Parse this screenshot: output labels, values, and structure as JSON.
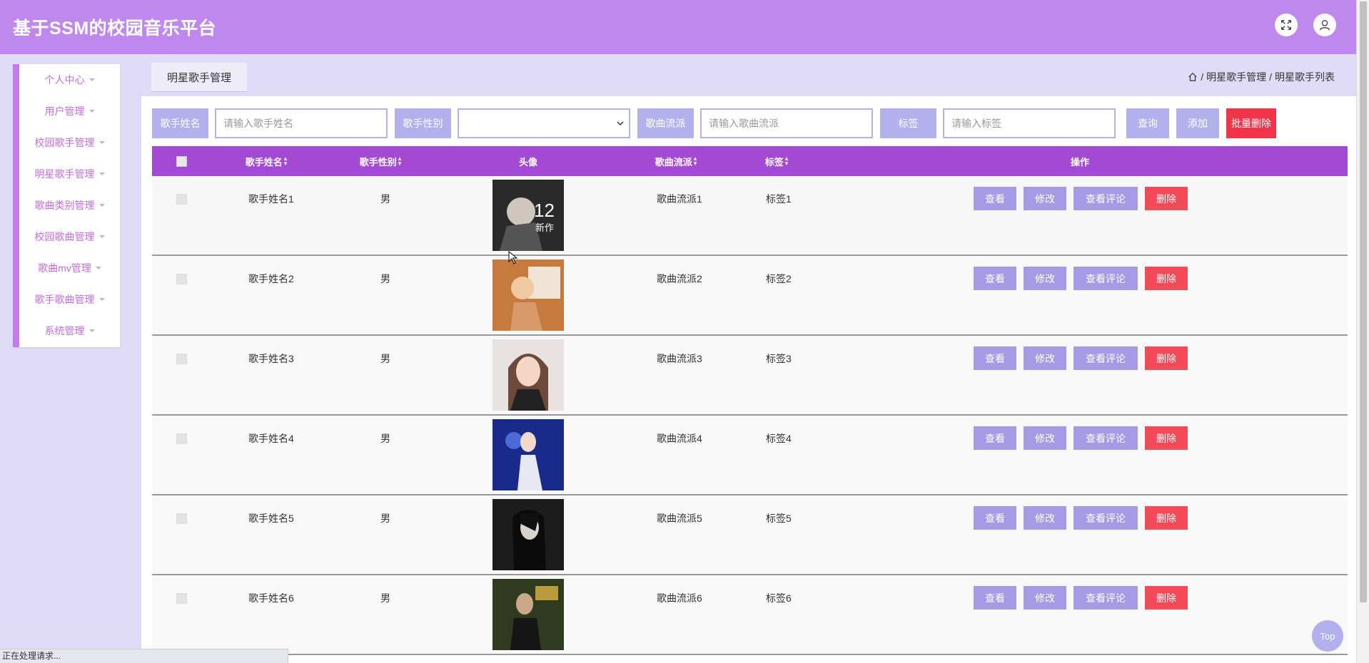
{
  "app": {
    "title": "基于SSM的校园音乐平台"
  },
  "colors": {
    "header": "#bf88ee",
    "accent": "#a449d4",
    "button": "#a49ae6",
    "danger": "#f24a58",
    "sidebar_text": "#c36cdc"
  },
  "sidebar": {
    "items": [
      {
        "label": "个人中心"
      },
      {
        "label": "用户管理"
      },
      {
        "label": "校园歌手管理"
      },
      {
        "label": "明星歌手管理"
      },
      {
        "label": "歌曲类别管理"
      },
      {
        "label": "校园歌曲管理"
      },
      {
        "label": "歌曲mv管理"
      },
      {
        "label": "歌手歌曲管理"
      },
      {
        "label": "系统管理"
      }
    ]
  },
  "page": {
    "tab": "明星歌手管理"
  },
  "breadcrumb": {
    "sep": "/",
    "level1": "明星歌手管理",
    "level2": "明星歌手列表"
  },
  "search": {
    "name_label": "歌手姓名",
    "name_placeholder": "请输入歌手姓名",
    "gender_label": "歌手性别",
    "gender_value": "",
    "genre_label": "歌曲流派",
    "genre_placeholder": "请输入歌曲流派",
    "tag_label": "标签",
    "tag_placeholder": "请输入标签",
    "query_btn": "查询",
    "add_btn": "添加",
    "batch_delete_btn": "批量删除"
  },
  "table": {
    "columns": [
      "歌手姓名",
      "歌手性别",
      "头像",
      "歌曲流派",
      "标签",
      "操作"
    ],
    "actions": {
      "view": "查看",
      "edit": "修改",
      "comments": "查看评论",
      "delete": "删除"
    },
    "rows": [
      {
        "name": "歌手姓名1",
        "gender": "男",
        "genre": "歌曲流派1",
        "tag": "标签1"
      },
      {
        "name": "歌手姓名2",
        "gender": "男",
        "genre": "歌曲流派2",
        "tag": "标签2"
      },
      {
        "name": "歌手姓名3",
        "gender": "男",
        "genre": "歌曲流派3",
        "tag": "标签3"
      },
      {
        "name": "歌手姓名4",
        "gender": "男",
        "genre": "歌曲流派4",
        "tag": "标签4"
      },
      {
        "name": "歌手姓名5",
        "gender": "男",
        "genre": "歌曲流派5",
        "tag": "标签5"
      },
      {
        "name": "歌手姓名6",
        "gender": "男",
        "genre": "歌曲流派6",
        "tag": "标签6"
      }
    ]
  },
  "status_bar": "正在处理请求...",
  "top_button": "Top"
}
